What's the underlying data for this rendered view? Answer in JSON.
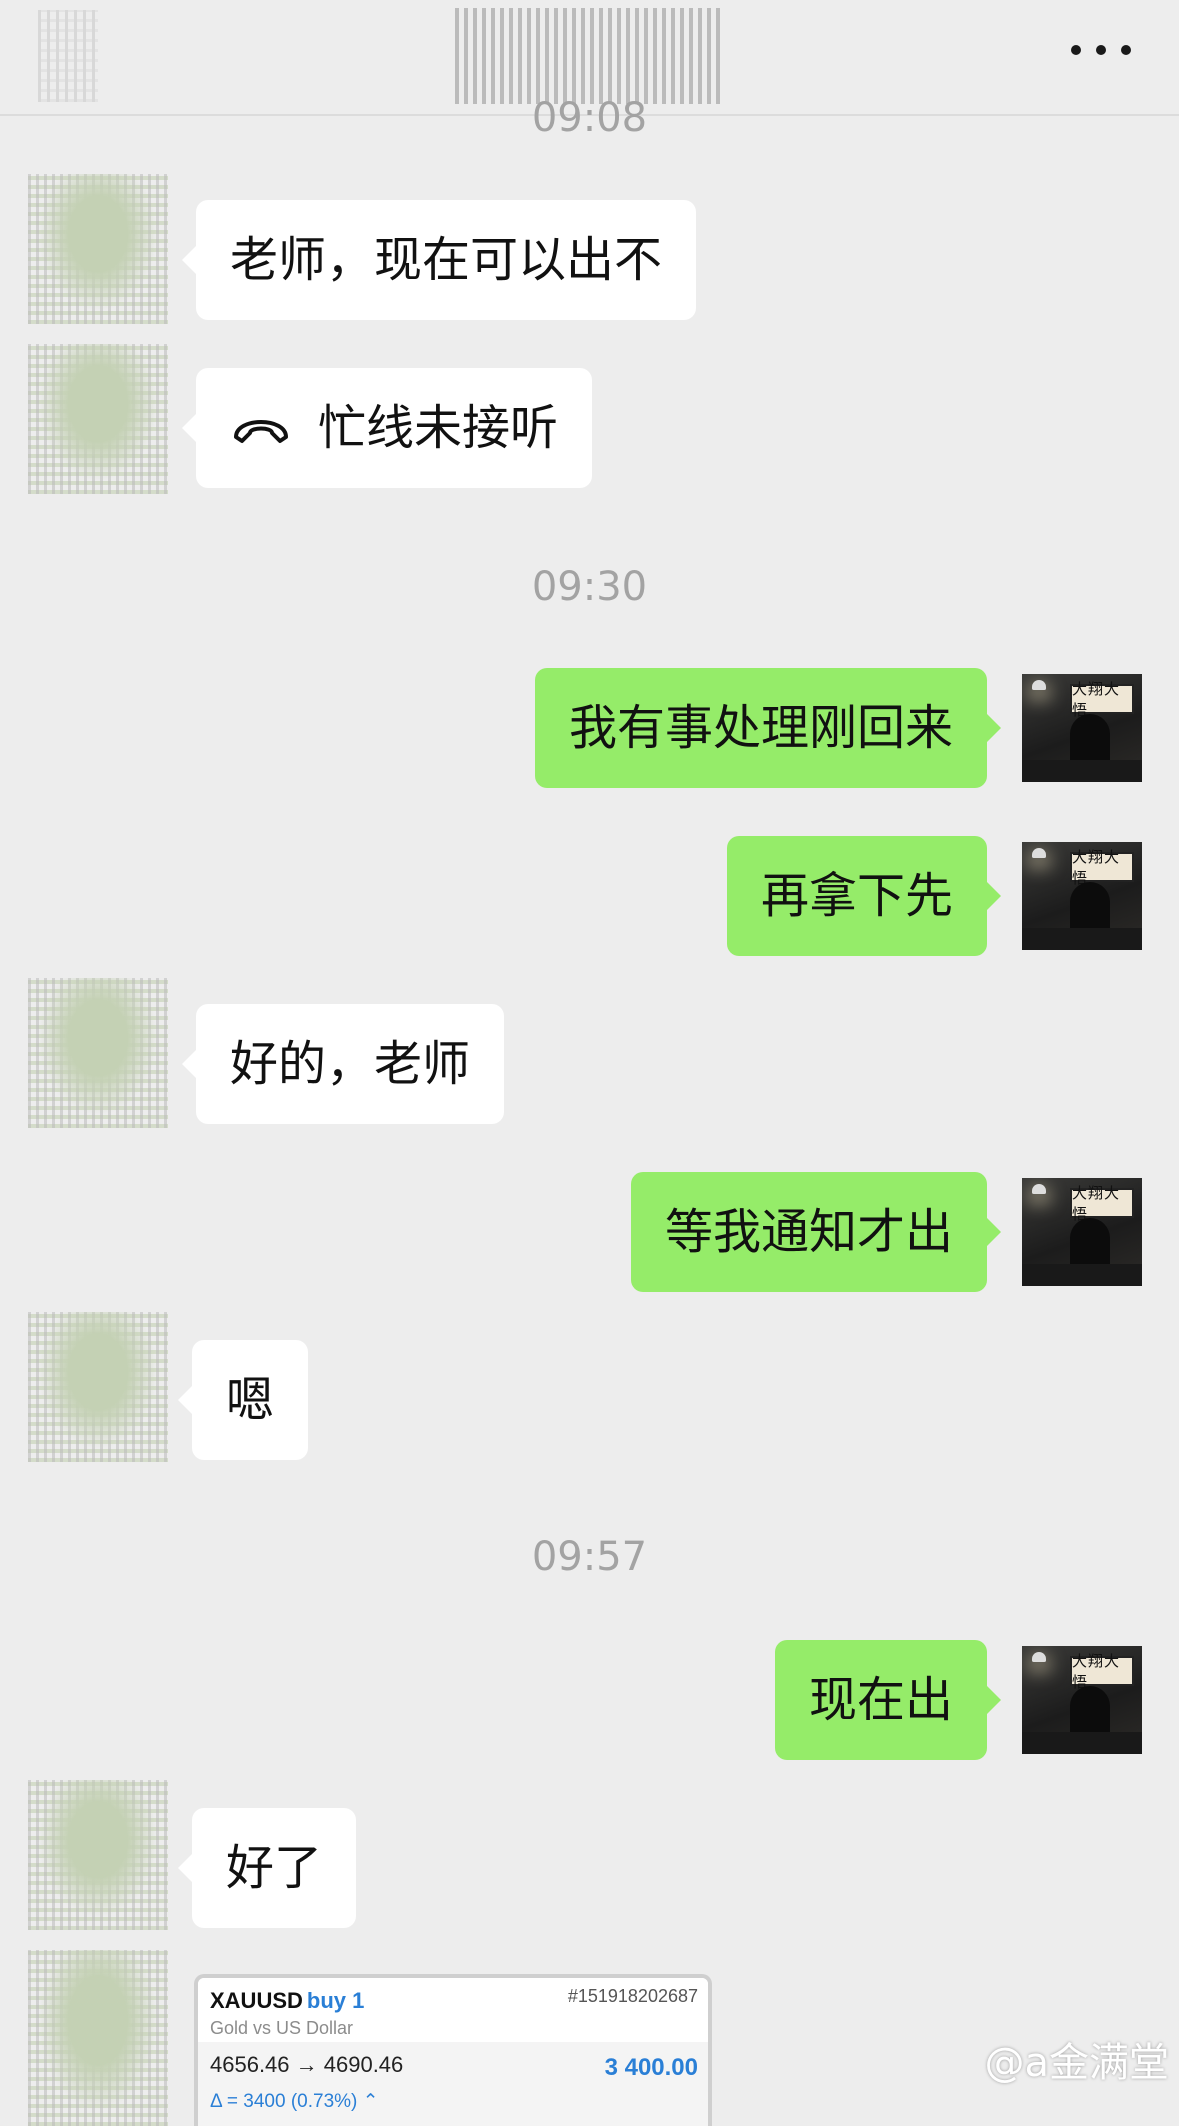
{
  "header": {
    "more_icon": "more-horizontal-icon"
  },
  "timestamps": [
    "09:08",
    "09:30",
    "09:57"
  ],
  "messages": [
    {
      "side": "left",
      "text": "老师，现在可以出不"
    },
    {
      "side": "left",
      "text": "忙线未接听",
      "icon": "phone-hangup-icon"
    },
    {
      "side": "right",
      "text": "我有事处理刚回来"
    },
    {
      "side": "right",
      "text": "再拿下先"
    },
    {
      "side": "left",
      "text": "好的，老师"
    },
    {
      "side": "right",
      "text": "等我通知才出"
    },
    {
      "side": "left",
      "text": "嗯"
    },
    {
      "side": "right",
      "text": "现在出"
    },
    {
      "side": "left",
      "text": "好了"
    }
  ],
  "self_avatar": {
    "plaque_text": "大翔大悟"
  },
  "trade_card": {
    "symbol": "XAUUSD",
    "side": "buy 1",
    "ticket": "#151918202687",
    "description": "Gold vs US Dollar",
    "prices": "4656.46 → 4690.46",
    "profit": "3 400.00",
    "delta": "Δ = 3400 (0.73%) ⌃"
  },
  "watermark": "@a金满堂",
  "colors": {
    "self_bubble": "#95ec69",
    "other_bubble": "#ffffff",
    "background": "#ededed"
  }
}
